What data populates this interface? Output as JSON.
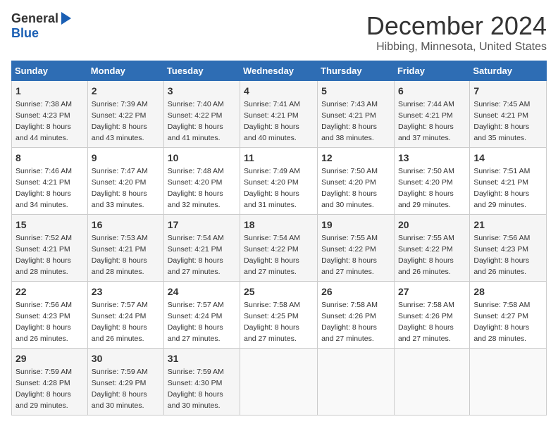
{
  "logo": {
    "general": "General",
    "blue": "Blue"
  },
  "title": "December 2024",
  "subtitle": "Hibbing, Minnesota, United States",
  "weekdays": [
    "Sunday",
    "Monday",
    "Tuesday",
    "Wednesday",
    "Thursday",
    "Friday",
    "Saturday"
  ],
  "weeks": [
    [
      {
        "day": "1",
        "sunrise": "Sunrise: 7:38 AM",
        "sunset": "Sunset: 4:23 PM",
        "daylight": "Daylight: 8 hours and 44 minutes."
      },
      {
        "day": "2",
        "sunrise": "Sunrise: 7:39 AM",
        "sunset": "Sunset: 4:22 PM",
        "daylight": "Daylight: 8 hours and 43 minutes."
      },
      {
        "day": "3",
        "sunrise": "Sunrise: 7:40 AM",
        "sunset": "Sunset: 4:22 PM",
        "daylight": "Daylight: 8 hours and 41 minutes."
      },
      {
        "day": "4",
        "sunrise": "Sunrise: 7:41 AM",
        "sunset": "Sunset: 4:21 PM",
        "daylight": "Daylight: 8 hours and 40 minutes."
      },
      {
        "day": "5",
        "sunrise": "Sunrise: 7:43 AM",
        "sunset": "Sunset: 4:21 PM",
        "daylight": "Daylight: 8 hours and 38 minutes."
      },
      {
        "day": "6",
        "sunrise": "Sunrise: 7:44 AM",
        "sunset": "Sunset: 4:21 PM",
        "daylight": "Daylight: 8 hours and 37 minutes."
      },
      {
        "day": "7",
        "sunrise": "Sunrise: 7:45 AM",
        "sunset": "Sunset: 4:21 PM",
        "daylight": "Daylight: 8 hours and 35 minutes."
      }
    ],
    [
      {
        "day": "8",
        "sunrise": "Sunrise: 7:46 AM",
        "sunset": "Sunset: 4:21 PM",
        "daylight": "Daylight: 8 hours and 34 minutes."
      },
      {
        "day": "9",
        "sunrise": "Sunrise: 7:47 AM",
        "sunset": "Sunset: 4:20 PM",
        "daylight": "Daylight: 8 hours and 33 minutes."
      },
      {
        "day": "10",
        "sunrise": "Sunrise: 7:48 AM",
        "sunset": "Sunset: 4:20 PM",
        "daylight": "Daylight: 8 hours and 32 minutes."
      },
      {
        "day": "11",
        "sunrise": "Sunrise: 7:49 AM",
        "sunset": "Sunset: 4:20 PM",
        "daylight": "Daylight: 8 hours and 31 minutes."
      },
      {
        "day": "12",
        "sunrise": "Sunrise: 7:50 AM",
        "sunset": "Sunset: 4:20 PM",
        "daylight": "Daylight: 8 hours and 30 minutes."
      },
      {
        "day": "13",
        "sunrise": "Sunrise: 7:50 AM",
        "sunset": "Sunset: 4:20 PM",
        "daylight": "Daylight: 8 hours and 29 minutes."
      },
      {
        "day": "14",
        "sunrise": "Sunrise: 7:51 AM",
        "sunset": "Sunset: 4:21 PM",
        "daylight": "Daylight: 8 hours and 29 minutes."
      }
    ],
    [
      {
        "day": "15",
        "sunrise": "Sunrise: 7:52 AM",
        "sunset": "Sunset: 4:21 PM",
        "daylight": "Daylight: 8 hours and 28 minutes."
      },
      {
        "day": "16",
        "sunrise": "Sunrise: 7:53 AM",
        "sunset": "Sunset: 4:21 PM",
        "daylight": "Daylight: 8 hours and 28 minutes."
      },
      {
        "day": "17",
        "sunrise": "Sunrise: 7:54 AM",
        "sunset": "Sunset: 4:21 PM",
        "daylight": "Daylight: 8 hours and 27 minutes."
      },
      {
        "day": "18",
        "sunrise": "Sunrise: 7:54 AM",
        "sunset": "Sunset: 4:22 PM",
        "daylight": "Daylight: 8 hours and 27 minutes."
      },
      {
        "day": "19",
        "sunrise": "Sunrise: 7:55 AM",
        "sunset": "Sunset: 4:22 PM",
        "daylight": "Daylight: 8 hours and 27 minutes."
      },
      {
        "day": "20",
        "sunrise": "Sunrise: 7:55 AM",
        "sunset": "Sunset: 4:22 PM",
        "daylight": "Daylight: 8 hours and 26 minutes."
      },
      {
        "day": "21",
        "sunrise": "Sunrise: 7:56 AM",
        "sunset": "Sunset: 4:23 PM",
        "daylight": "Daylight: 8 hours and 26 minutes."
      }
    ],
    [
      {
        "day": "22",
        "sunrise": "Sunrise: 7:56 AM",
        "sunset": "Sunset: 4:23 PM",
        "daylight": "Daylight: 8 hours and 26 minutes."
      },
      {
        "day": "23",
        "sunrise": "Sunrise: 7:57 AM",
        "sunset": "Sunset: 4:24 PM",
        "daylight": "Daylight: 8 hours and 26 minutes."
      },
      {
        "day": "24",
        "sunrise": "Sunrise: 7:57 AM",
        "sunset": "Sunset: 4:24 PM",
        "daylight": "Daylight: 8 hours and 27 minutes."
      },
      {
        "day": "25",
        "sunrise": "Sunrise: 7:58 AM",
        "sunset": "Sunset: 4:25 PM",
        "daylight": "Daylight: 8 hours and 27 minutes."
      },
      {
        "day": "26",
        "sunrise": "Sunrise: 7:58 AM",
        "sunset": "Sunset: 4:26 PM",
        "daylight": "Daylight: 8 hours and 27 minutes."
      },
      {
        "day": "27",
        "sunrise": "Sunrise: 7:58 AM",
        "sunset": "Sunset: 4:26 PM",
        "daylight": "Daylight: 8 hours and 27 minutes."
      },
      {
        "day": "28",
        "sunrise": "Sunrise: 7:58 AM",
        "sunset": "Sunset: 4:27 PM",
        "daylight": "Daylight: 8 hours and 28 minutes."
      }
    ],
    [
      {
        "day": "29",
        "sunrise": "Sunrise: 7:59 AM",
        "sunset": "Sunset: 4:28 PM",
        "daylight": "Daylight: 8 hours and 29 minutes."
      },
      {
        "day": "30",
        "sunrise": "Sunrise: 7:59 AM",
        "sunset": "Sunset: 4:29 PM",
        "daylight": "Daylight: 8 hours and 30 minutes."
      },
      {
        "day": "31",
        "sunrise": "Sunrise: 7:59 AM",
        "sunset": "Sunset: 4:30 PM",
        "daylight": "Daylight: 8 hours and 30 minutes."
      },
      null,
      null,
      null,
      null
    ]
  ]
}
